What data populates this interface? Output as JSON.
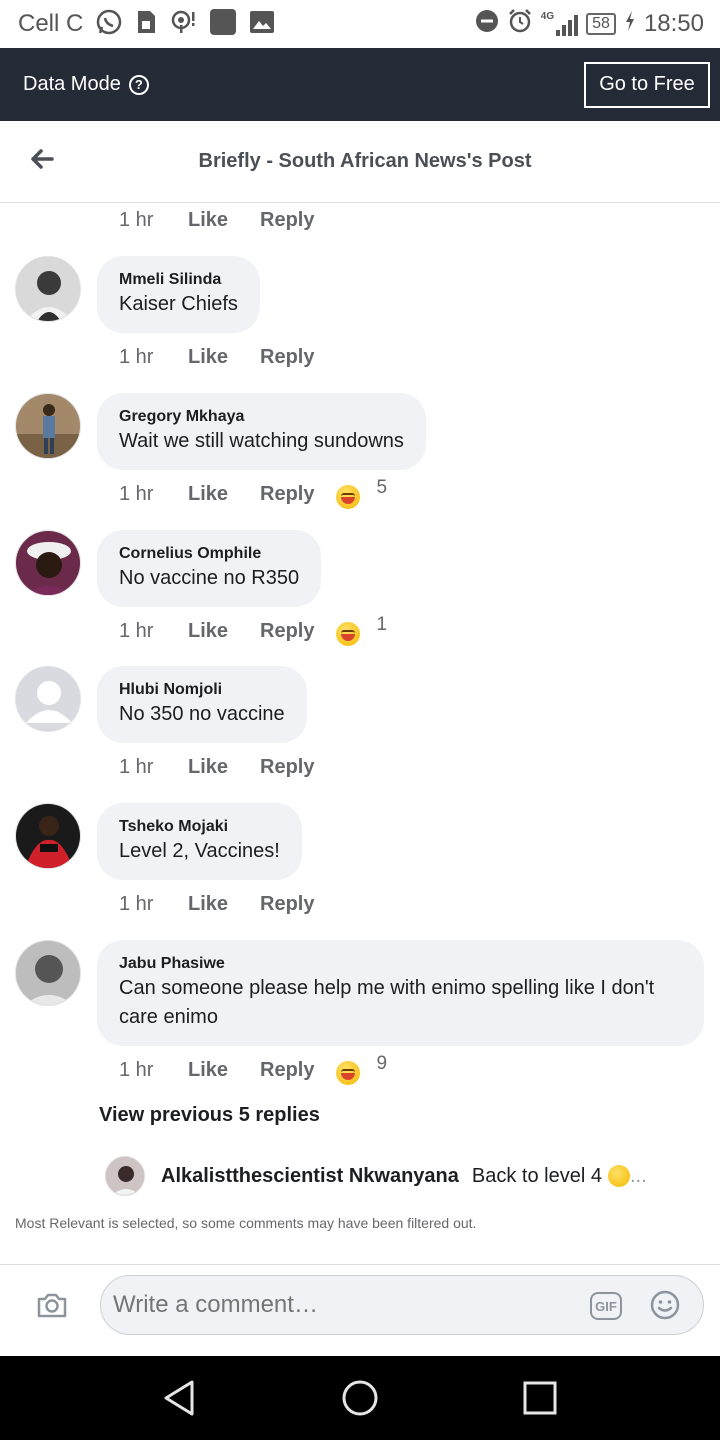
{
  "status_bar": {
    "carrier": "Cell C",
    "network": "4G",
    "battery": "58",
    "time": "18:50"
  },
  "data_bar": {
    "label": "Data Mode",
    "help": "?",
    "go_free": "Go to Free"
  },
  "header": {
    "title": "Briefly - South African News's Post"
  },
  "top_meta": {
    "time": "1 hr",
    "like": "Like",
    "reply": "Reply"
  },
  "comments": [
    {
      "name": "Mmeli Silinda",
      "text": "Kaiser Chiefs",
      "time": "1 hr",
      "like": "Like",
      "reply": "Reply",
      "reactions": ""
    },
    {
      "name": "Gregory Mkhaya",
      "text": "Wait we still watching sundowns",
      "time": "1 hr",
      "like": "Like",
      "reply": "Reply",
      "reactions": "5"
    },
    {
      "name": "Cornelius Omphile",
      "text": "No vaccine no R350",
      "time": "1 hr",
      "like": "Like",
      "reply": "Reply",
      "reactions": "1"
    },
    {
      "name": "Hlubi Nomjoli",
      "text": "No 350 no vaccine",
      "time": "1 hr",
      "like": "Like",
      "reply": "Reply",
      "reactions": ""
    },
    {
      "name": "Tsheko Mojaki",
      "text": "Level 2, Vaccines!",
      "time": "1 hr",
      "like": "Like",
      "reply": "Reply",
      "reactions": ""
    },
    {
      "name": "Jabu Phasiwe",
      "text": "Can someone please help me with enimo spelling like I don't care enimo",
      "time": "1 hr",
      "like": "Like",
      "reply": "Reply",
      "reactions": "9"
    }
  ],
  "view_previous": "View previous 5 replies",
  "reply_preview": {
    "name": "Alkalistthescientist Nkwanyana",
    "text": "Back to level 4",
    "more": "..."
  },
  "filter_note": "Most Relevant is selected, so some comments may have been filtered out.",
  "composer": {
    "placeholder": "Write a comment…",
    "gif": "GIF"
  },
  "colors": {
    "data_bar_bg": "#242a36",
    "bubble_bg": "#f0f2f5",
    "meta_text": "#65676b"
  }
}
